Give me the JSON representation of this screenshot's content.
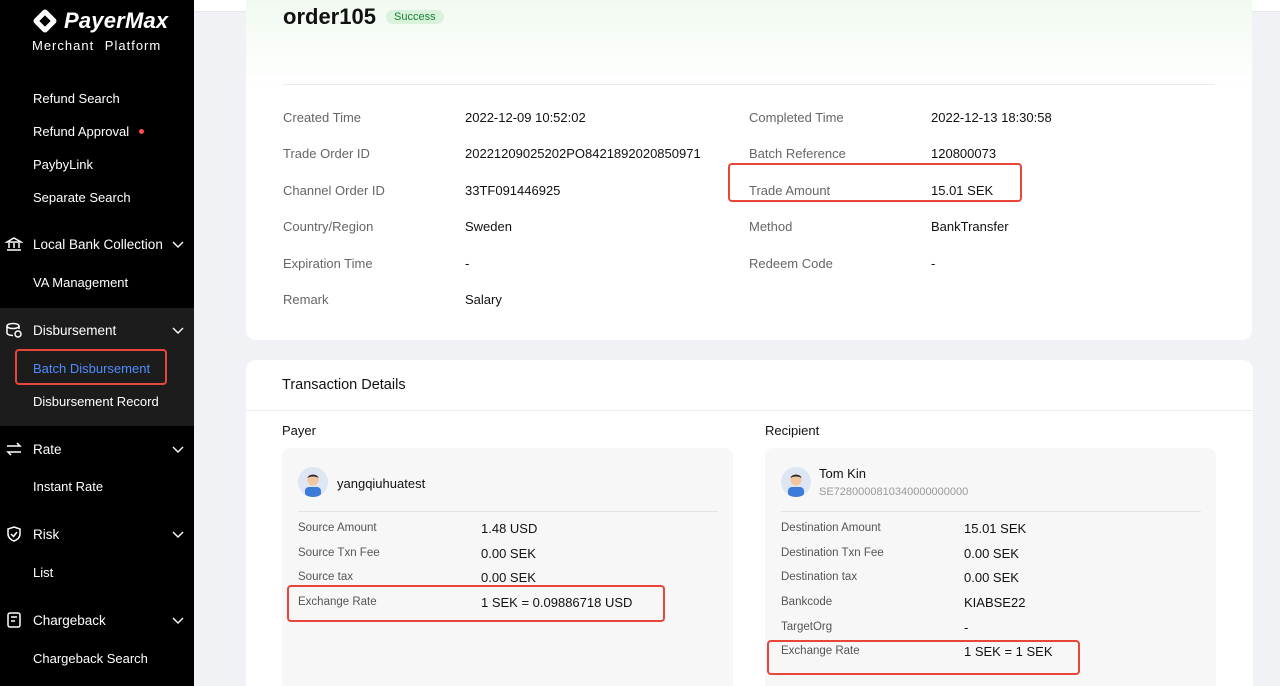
{
  "brand": {
    "name": "PayerMax",
    "subtitle": "Merchant Platform"
  },
  "sidebar": {
    "items": [
      {
        "label": "Refund Search"
      },
      {
        "label": "Refund Approval"
      },
      {
        "label": "PaybyLink"
      },
      {
        "label": "Separate Search"
      },
      {
        "label": "Local Bank Collection"
      },
      {
        "label": "VA Management"
      },
      {
        "label": "Disbursement"
      },
      {
        "label": "Batch Disbursement"
      },
      {
        "label": "Disbursement Record"
      },
      {
        "label": "Rate"
      },
      {
        "label": "Instant Rate"
      },
      {
        "label": "Risk"
      },
      {
        "label": "List"
      },
      {
        "label": "Chargeback"
      },
      {
        "label": "Chargeback Search"
      }
    ],
    "active_color": "#4f8cff"
  },
  "order": {
    "title": "order105",
    "status": "Success",
    "fields_left": [
      {
        "label": "Created Time",
        "value": "2022-12-09 10:52:02"
      },
      {
        "label": "Trade Order ID",
        "value": "20221209025202PO8421892020850971"
      },
      {
        "label": "Channel Order ID",
        "value": "33TF091446925"
      },
      {
        "label": "Country/Region",
        "value": "Sweden"
      },
      {
        "label": "Expiration Time",
        "value": "-"
      },
      {
        "label": "Remark",
        "value": "Salary"
      }
    ],
    "fields_right": [
      {
        "label": "Completed Time",
        "value": "2022-12-13 18:30:58"
      },
      {
        "label": "Batch Reference",
        "value": "120800073"
      },
      {
        "label": "Trade Amount",
        "value": "15.01 SEK"
      },
      {
        "label": "Method",
        "value": "BankTransfer"
      },
      {
        "label": "Redeem Code",
        "value": "-"
      }
    ]
  },
  "transaction": {
    "title": "Transaction Details",
    "payer": {
      "heading": "Payer",
      "name": "yangqiuhuatest",
      "fields": [
        {
          "label": "Source Amount",
          "value": "1.48 USD"
        },
        {
          "label": "Source Txn Fee",
          "value": "0.00 SEK"
        },
        {
          "label": "Source tax",
          "value": "0.00 SEK"
        },
        {
          "label": "Exchange Rate",
          "value": "1 SEK = 0.09886718 USD"
        }
      ]
    },
    "recipient": {
      "heading": "Recipient",
      "name": "Tom Kin",
      "account": "SE7280000810340000000000",
      "fields": [
        {
          "label": "Destination Amount",
          "value": "15.01 SEK"
        },
        {
          "label": "Destination Txn Fee",
          "value": "0.00 SEK"
        },
        {
          "label": "Destination tax",
          "value": "0.00 SEK"
        },
        {
          "label": "Bankcode",
          "value": "KIABSE22"
        },
        {
          "label": "TargetOrg",
          "value": "-"
        },
        {
          "label": "Exchange Rate",
          "value": "1 SEK = 1 SEK"
        }
      ]
    }
  },
  "colors": {
    "highlight": "#e8463a",
    "success_bg": "#d9f2dc",
    "success_text": "#1a7f37"
  }
}
